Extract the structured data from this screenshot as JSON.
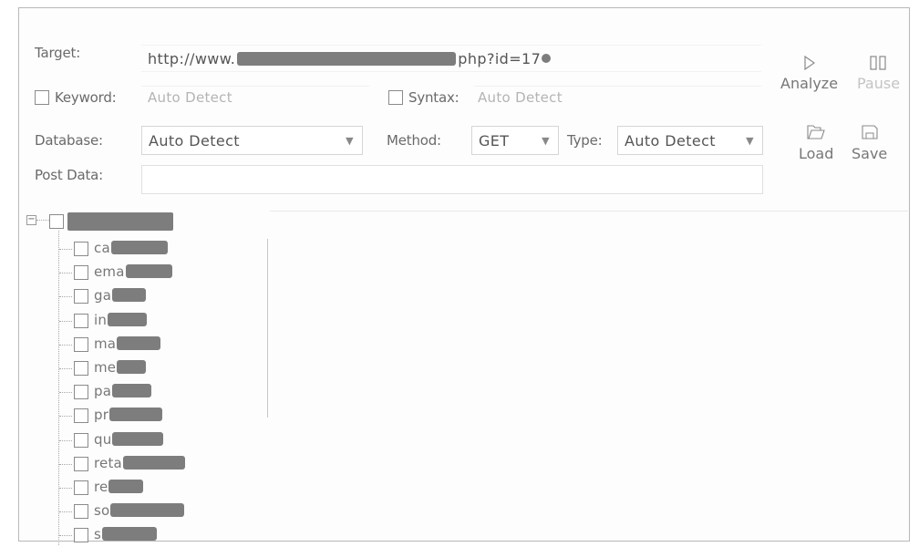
{
  "form": {
    "target_label": "Target:",
    "target_url_prefix": "http://www.",
    "target_url_suffix": "php?id=17",
    "keyword_label": "Keyword:",
    "keyword_value": "Auto Detect",
    "syntax_label": "Syntax:",
    "syntax_value": "Auto Detect",
    "database_label": "Database:",
    "database_value": "Auto Detect",
    "method_label": "Method:",
    "method_value": "GET",
    "type_label": "Type:",
    "type_value": "Auto Detect",
    "post_data_label": "Post Data:",
    "post_data_value": ""
  },
  "toolbar": {
    "analyze_label": "Analyze",
    "pause_label": "Pause",
    "load_label": "Load",
    "save_label": "Save"
  },
  "tree": {
    "items": [
      {
        "label": "ca"
      },
      {
        "label": "ema"
      },
      {
        "label": "ga"
      },
      {
        "label": "in"
      },
      {
        "label": "ma"
      },
      {
        "label": "me"
      },
      {
        "label": "pa"
      },
      {
        "label": "pr"
      },
      {
        "label": "qu"
      },
      {
        "label": "reta"
      },
      {
        "label": "re"
      },
      {
        "label": "so"
      },
      {
        "label": "s"
      }
    ]
  },
  "colors": {
    "text": "#6a6a6a",
    "placeholder": "#b4b4b4",
    "redaction": "#7d7d7d",
    "border": "#d6d6d6"
  }
}
